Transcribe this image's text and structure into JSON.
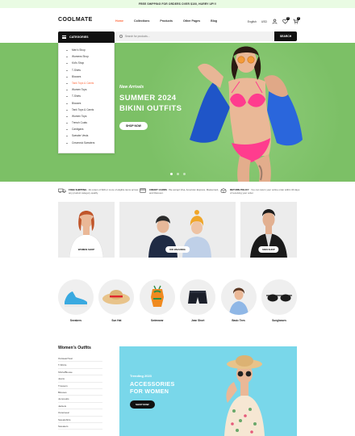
{
  "topbar": {
    "text": "Free shipping for orders over $100, hurry up!!!"
  },
  "header": {
    "logo": "COOLMATE",
    "nav": [
      "Home",
      "Collections",
      "Products",
      "Other Pages",
      "Blog"
    ],
    "active_nav": "Home",
    "language": "English",
    "currency": "USD",
    "wishlist_count": "0",
    "cart_count": "0"
  },
  "categories": {
    "title": "Categories",
    "items": [
      "Men's Shop",
      "Womens Shop",
      "Kid's Shop",
      "T-Shirts",
      "Blouses",
      "Tank Tops & Camis",
      "Women Tops",
      "T-Shirts",
      "Blouses",
      "Tank Tops & Camis",
      "Women Tops",
      "Trench Coats",
      "Cardigans",
      "Sweater Vests",
      "Crewneck Sweaters"
    ],
    "active_index": 5
  },
  "search": {
    "placeholder": "Search for products...",
    "button": "Search"
  },
  "hero": {
    "kicker": "New Arrivals",
    "title_line1": "SUMMER 2024",
    "title_line2": "BIKINI OUTFITS",
    "button": "Shop now",
    "colors": {
      "background": "#7cc066",
      "accent": "#ff6a3d"
    }
  },
  "features": [
    {
      "title": "Free Shipping",
      "text": " : All orders of $49 or more of eligible items across any product category qualify."
    },
    {
      "title": "Credit Cards",
      "text": " : We accept Visa, American Express, Mastercard, and Discover."
    },
    {
      "title": "Return Policy",
      "text": " : You can return your online order within 30 days of receiving your order."
    }
  ],
  "banners": [
    {
      "button": "Women shop"
    },
    {
      "button": "Kid wearing"
    },
    {
      "button": "Men shop"
    }
  ],
  "circle_categories": [
    "Sneakers",
    "Sun Hat",
    "Swimwear",
    "Jean Short",
    "Basic Tees",
    "Sunglasses"
  ],
  "womens_outfits": {
    "title": "Women's Outfits",
    "items": [
      "Outwear/Vest",
      "T-Shirts",
      "Shirts/Blouse",
      "Jeans",
      "Trousers",
      "Blouses",
      "Jumpsuits",
      "Jackets",
      "Outerwear",
      "Sweatshirts",
      "Sweaters"
    ]
  },
  "promo": {
    "kicker": "Trending 2023",
    "title_line1": "ACCESSORIES",
    "title_line2": "FOR WOMEN",
    "button": "Shop now"
  }
}
